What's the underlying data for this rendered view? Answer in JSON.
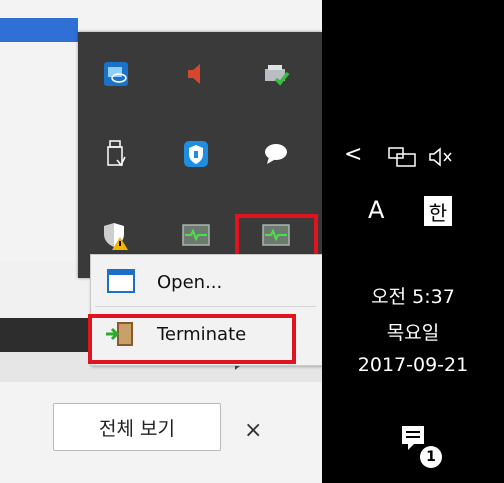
{
  "background": {
    "view_all_button": "전체 보기",
    "close_label": "×"
  },
  "tray_overflow": {
    "icons": [
      "intel-graphics-icon",
      "speaker-icon",
      "printer-check-icon",
      "usb-drive-icon",
      "shield-security-icon",
      "chat-bubble-icon",
      "uac-shield-icon",
      "monitor-app-icon",
      "monitor-app-highlighted-icon"
    ]
  },
  "context_menu": {
    "items": [
      {
        "label": "Open...",
        "icon": "window-icon"
      },
      {
        "label": "Terminate",
        "icon": "exit-door-icon"
      }
    ]
  },
  "taskbar": {
    "chevron": "<",
    "input_mode_latin": "A",
    "input_mode_korean": "한",
    "time": "오전 5:37",
    "day": "목요일",
    "date": "2017-09-21",
    "notification_count": "1"
  },
  "colors": {
    "highlight_red": "#e0141e",
    "tray_bg": "#3a3a3a",
    "taskbar_bg": "#000000"
  }
}
